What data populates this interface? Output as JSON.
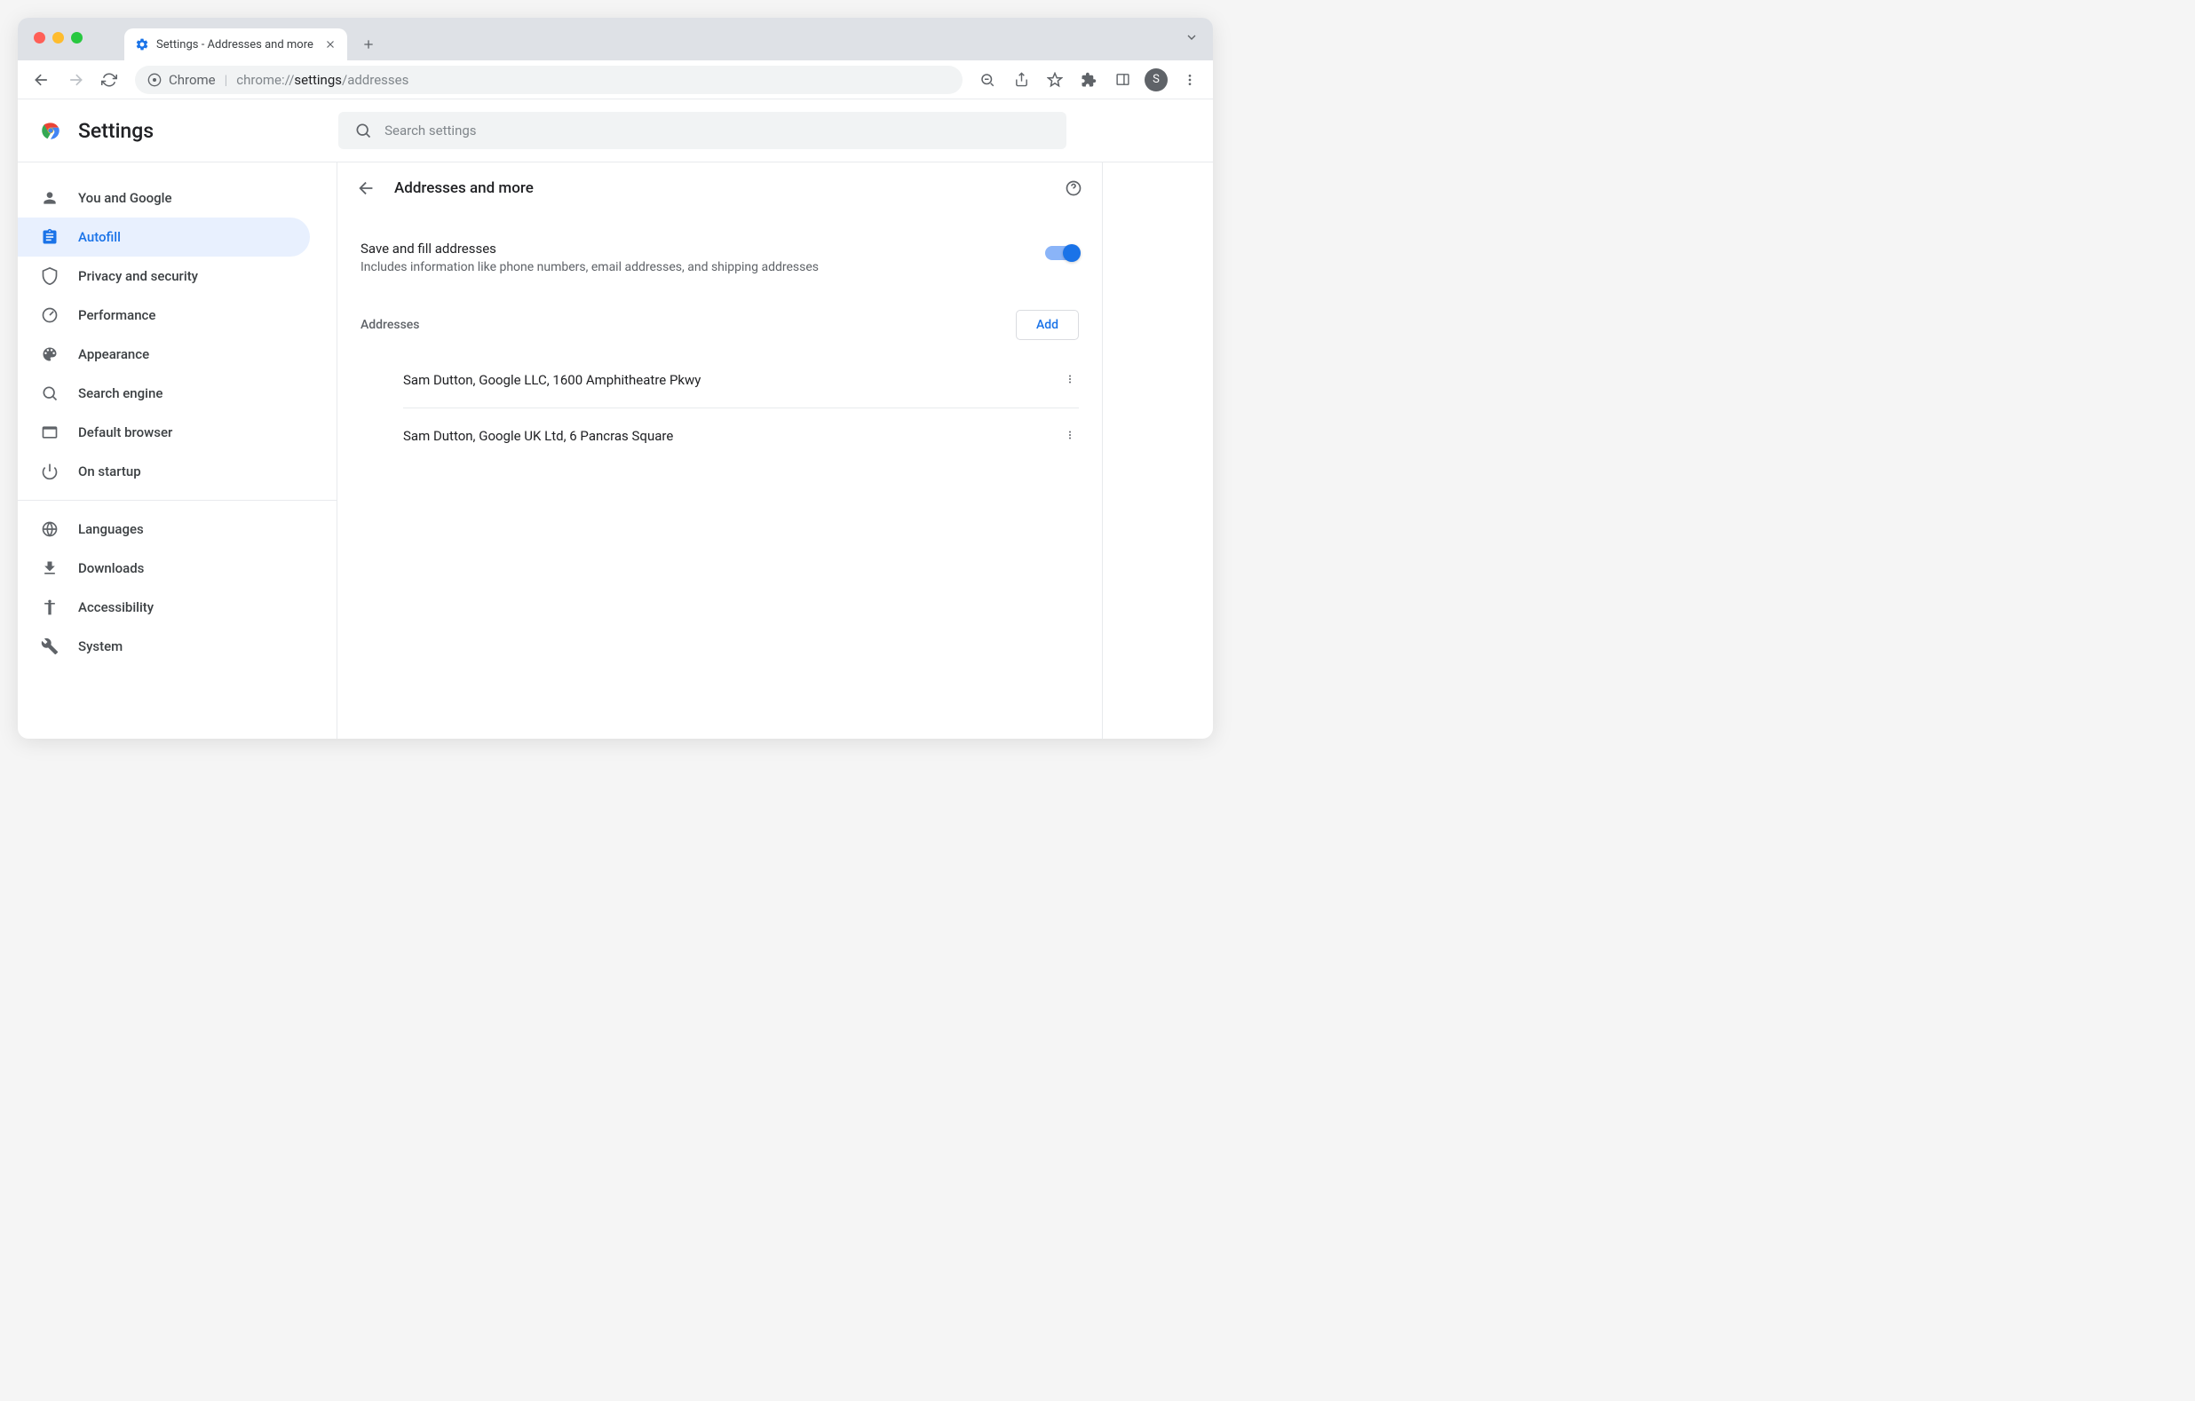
{
  "tab": {
    "title": "Settings - Addresses and more"
  },
  "omnibox": {
    "secure_label": "Chrome",
    "url_prefix": "chrome://",
    "url_bold": "settings",
    "url_suffix": "/addresses"
  },
  "avatar_letter": "S",
  "settings_title": "Settings",
  "search": {
    "placeholder": "Search settings"
  },
  "sidebar": {
    "items": [
      {
        "label": "You and Google"
      },
      {
        "label": "Autofill"
      },
      {
        "label": "Privacy and security"
      },
      {
        "label": "Performance"
      },
      {
        "label": "Appearance"
      },
      {
        "label": "Search engine"
      },
      {
        "label": "Default browser"
      },
      {
        "label": "On startup"
      }
    ],
    "lower": [
      {
        "label": "Languages"
      },
      {
        "label": "Downloads"
      },
      {
        "label": "Accessibility"
      },
      {
        "label": "System"
      }
    ]
  },
  "panel": {
    "title": "Addresses and more",
    "toggle_label": "Save and fill addresses",
    "toggle_desc": "Includes information like phone numbers, email addresses, and shipping addresses",
    "section_label": "Addresses",
    "add_label": "Add",
    "addresses": [
      {
        "text": "Sam Dutton, Google LLC, 1600 Amphitheatre Pkwy"
      },
      {
        "text": "Sam Dutton, Google UK Ltd, 6 Pancras Square"
      }
    ]
  }
}
